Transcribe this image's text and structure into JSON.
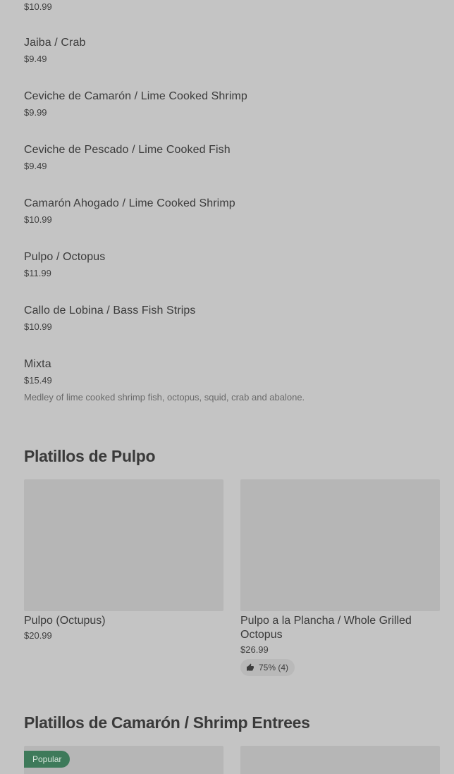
{
  "items": [
    {
      "name": "",
      "price": "$10.99"
    },
    {
      "name": "Jaiba / Crab",
      "price": "$9.49"
    },
    {
      "name": "Ceviche de Camarón / Lime Cooked Shrimp",
      "price": "$9.99"
    },
    {
      "name": "Ceviche de Pescado / Lime Cooked Fish",
      "price": "$9.49"
    },
    {
      "name": "Camarón Ahogado / Lime Cooked Shrimp",
      "price": "$10.99"
    },
    {
      "name": "Pulpo / Octopus",
      "price": "$11.99"
    },
    {
      "name": "Callo de Lobina / Bass Fish Strips",
      "price": "$10.99"
    },
    {
      "name": "Mixta",
      "price": "$15.49",
      "description": "Medley of lime cooked shrimp fish, octopus, squid, crab and abalone."
    }
  ],
  "sections": [
    {
      "title": "Platillos de Pulpo",
      "cards": [
        {
          "name": "Pulpo (Octupus)",
          "price": "$20.99"
        },
        {
          "name": "Pulpo a la Plancha / Whole Grilled Octopus",
          "price": "$26.99",
          "rating": "75% (4)",
          "rating_icon": "thumbs-up-icon"
        }
      ]
    },
    {
      "title": "Platillos de Camarón / Shrimp Entrees",
      "cards": [
        {
          "badge": "Popular"
        },
        {}
      ]
    }
  ],
  "colors": {
    "background": "#c4c4c4",
    "card_image": "#b6b6b6",
    "badge": "#3e7a5a"
  }
}
